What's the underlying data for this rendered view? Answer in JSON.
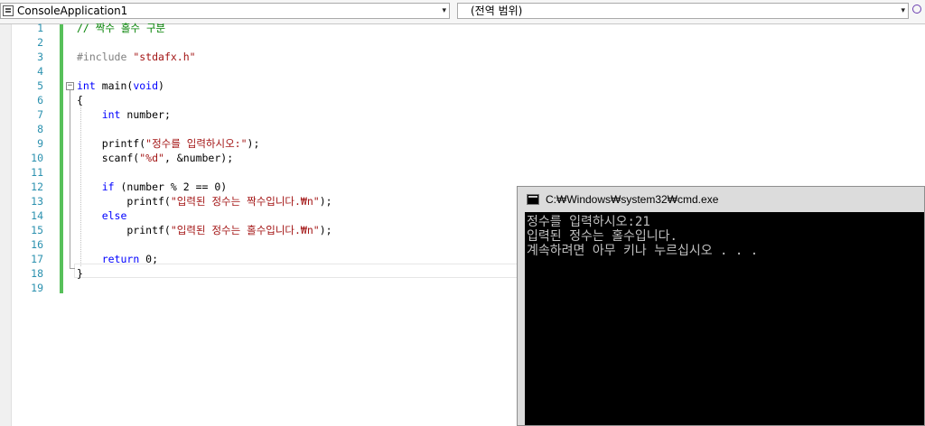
{
  "navbar": {
    "project_combo": "ConsoleApplication1",
    "scope_combo": "(전역 범위)",
    "dropdown_arrow": "▾"
  },
  "editor": {
    "lines": [
      {
        "num": "1",
        "text": "// 짝수 홀수 구분"
      },
      {
        "num": "2",
        "text": ""
      },
      {
        "num": "3",
        "text": "#include \"stdafx.h\""
      },
      {
        "num": "4",
        "text": ""
      },
      {
        "num": "5",
        "text": "int main(void)"
      },
      {
        "num": "6",
        "text": "{"
      },
      {
        "num": "7",
        "text": "    int number;"
      },
      {
        "num": "8",
        "text": ""
      },
      {
        "num": "9",
        "text": "    printf(\"정수를 입력하시오:\");"
      },
      {
        "num": "10",
        "text": "    scanf(\"%d\", &number);"
      },
      {
        "num": "11",
        "text": ""
      },
      {
        "num": "12",
        "text": "    if (number % 2 == 0)"
      },
      {
        "num": "13",
        "text": "        printf(\"입력된 정수는 짝수입니다.₩n\");"
      },
      {
        "num": "14",
        "text": "    else"
      },
      {
        "num": "15",
        "text": "        printf(\"입력된 정수는 홀수입니다.₩n\");"
      },
      {
        "num": "16",
        "text": ""
      },
      {
        "num": "17",
        "text": "    return 0;"
      },
      {
        "num": "18",
        "text": "}"
      },
      {
        "num": "19",
        "text": ""
      }
    ],
    "fold_symbol": "−"
  },
  "console": {
    "title": "C:₩Windows₩system32₩cmd.exe",
    "lines": [
      "정수를 입력하시오:21",
      "입력된 정수는 홀수입니다.",
      "계속하려면 아무 키나 누르십시오 . . ."
    ]
  },
  "colors": {
    "keyword": "#0000ff",
    "comment": "#008000",
    "string": "#a31515",
    "preprocessor": "#808080",
    "line_number": "#2b91af",
    "change_bar": "#57c05a"
  },
  "icons": [
    "class-icon",
    "dropdown-arrow-icon",
    "member-icon",
    "collapse-icon",
    "console-app-icon"
  ]
}
